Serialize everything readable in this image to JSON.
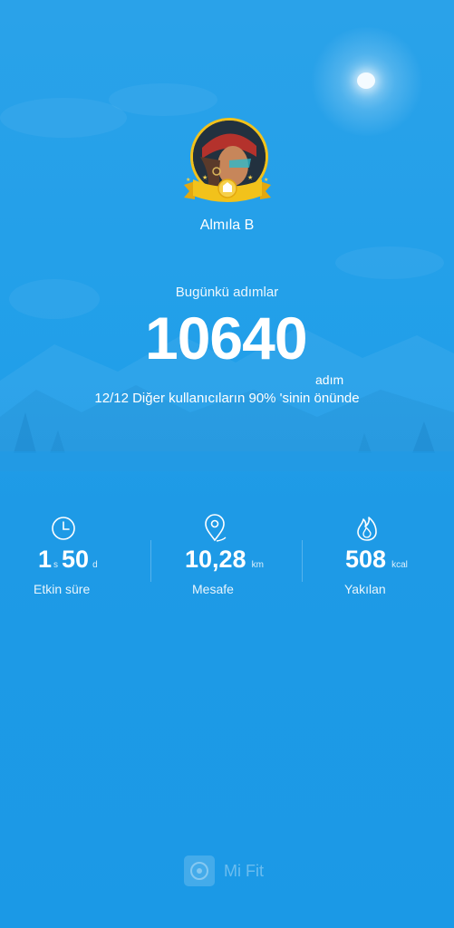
{
  "profile": {
    "name": "Almıla B"
  },
  "steps": {
    "title": "Bugünkü adımlar",
    "value": "10640",
    "unit": "adım",
    "rank_text": "12/12 Diğer kullanıcıların 90% 'sinin önünde"
  },
  "stats": [
    {
      "icon": "clock-icon",
      "hours": "1",
      "hours_unit": "s",
      "minutes": "50",
      "minutes_unit": "d",
      "label": "Etkin süre"
    },
    {
      "icon": "location-pin-icon",
      "value": "10,28",
      "unit": "km",
      "label": "Mesafe"
    },
    {
      "icon": "flame-icon",
      "value": "508",
      "unit": "kcal",
      "label": "Yakılan"
    }
  ],
  "brand": {
    "name": "Mi Fit"
  },
  "colors": {
    "background": "#1e9ae6",
    "badge_gold": "#f2c21b"
  }
}
